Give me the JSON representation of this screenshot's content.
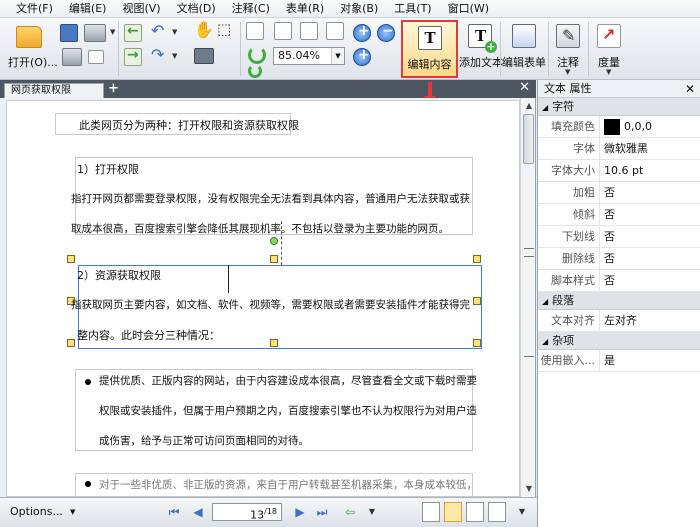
{
  "menu": [
    "文件(F)",
    "编辑(E)",
    "视图(V)",
    "文档(D)",
    "注释(C)",
    "表单(R)",
    "对象(B)",
    "工具(T)",
    "窗口(W)"
  ],
  "toolbar": {
    "open_label": "打开(O)...",
    "zoom_value": "85.04%",
    "edit_content_label": "编辑内容",
    "add_text_label": "添加文本",
    "edit_form_label": "编辑表单",
    "annotate_label": "注释",
    "measure_label": "度量"
  },
  "tab": {
    "title": "网页获取权限"
  },
  "document": {
    "intro": "此类网页分为两种：打开权限和资源获取权限",
    "s1_title": "1）打开权限",
    "s1_line1": "指打开网页都需要登录权限，没有权限完全无法看到具体内容，普通用户无法获取或获",
    "s1_line2": "取成本很高，百度搜索引擎会降低其展现机率。不包括以登录为主要功能的网页。",
    "s2_title": "2）资源获取权限",
    "s2_line1": "指获取网页主要内容，如文档、软件、视频等，需要权限或者需要安装插件才能获得完",
    "s2_line2": "整内容。此时会分三种情况：",
    "b1_line1": "提供优质、正版内容的网站，由于内容建设成本很高，尽管查看全文或下载时需要",
    "b1_line2": "权限或安装插件，但属于用户预期之内，百度搜索引擎也不认为权限行为对用户造",
    "b1_line3": "成伤害，给予与正常可访问页面相同的对待。",
    "b2_line1": "对于一些非优质、非正版的资源，来自于用户转载甚至机器采集，本身成本较低，"
  },
  "panel": {
    "title": "文本 属性",
    "sections": {
      "char": "字符",
      "para": "段落",
      "misc": "杂项"
    },
    "char_rows": [
      {
        "k": "填充颜色",
        "v": "0,0,0",
        "swatch": "#000000"
      },
      {
        "k": "字体",
        "v": "微软雅黑"
      },
      {
        "k": "字体大小",
        "v": "10.6 pt"
      },
      {
        "k": "加粗",
        "v": "否"
      },
      {
        "k": "倾斜",
        "v": "否"
      },
      {
        "k": "下划线",
        "v": "否"
      },
      {
        "k": "删除线",
        "v": "否"
      },
      {
        "k": "脚本样式",
        "v": "否"
      }
    ],
    "para_rows": [
      {
        "k": "文本对齐",
        "v": "左对齐"
      }
    ],
    "misc_rows": [
      {
        "k": "使用嵌入...",
        "v": "是"
      }
    ]
  },
  "status": {
    "options_label": "Options...",
    "page_current": "13",
    "page_total": "/18"
  }
}
